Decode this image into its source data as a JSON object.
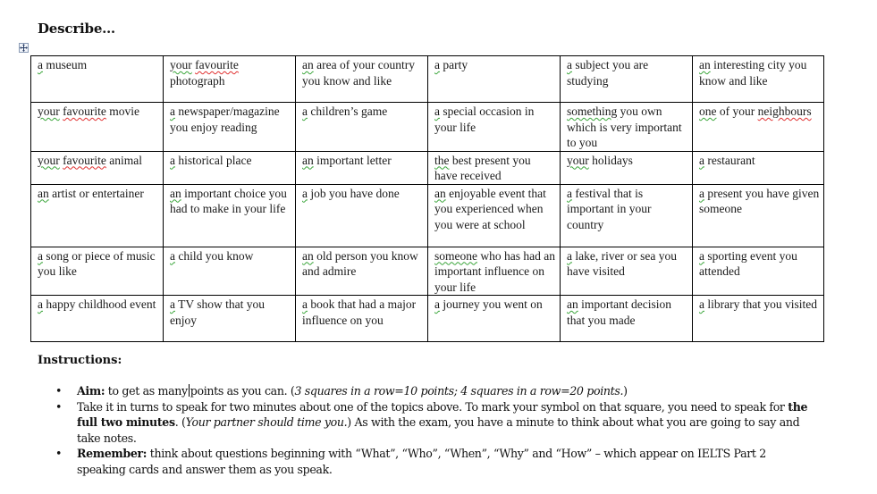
{
  "document": {
    "title": "Describe…",
    "move_handle_icon": "move-arrows-icon",
    "table": {
      "rows": [
        [
          {
            "first": "a",
            "rest": " museum",
            "first_check": "grammar"
          },
          {
            "first": "your",
            "mid": " ",
            "second": "favourite",
            "rest": " photograph",
            "first_check": "grammar",
            "second_check": "spelling"
          },
          {
            "first": "an",
            "rest": " area of your country you know and like",
            "first_check": "grammar"
          },
          {
            "first": "a",
            "rest": " party",
            "first_check": "grammar"
          },
          {
            "first": "a",
            "rest": " subject you are studying",
            "first_check": "grammar"
          },
          {
            "first": "an",
            "rest": " interesting city you know and like",
            "first_check": "grammar"
          }
        ],
        [
          {
            "first": "your",
            "mid": " ",
            "second": "favourite",
            "rest": " movie",
            "first_check": "grammar",
            "second_check": "spelling"
          },
          {
            "first": "a",
            "rest": " newspaper/magazine you enjoy reading",
            "first_check": "grammar"
          },
          {
            "first": "a",
            "rest": " children’s game",
            "first_check": "grammar"
          },
          {
            "first": "a",
            "rest": " special occasion in your life",
            "first_check": "grammar"
          },
          {
            "first": "something",
            "rest": " you own which is very important to you",
            "first_check": "grammar"
          },
          {
            "first": "one",
            "rest": " of your ",
            "second": "neighbours",
            "first_check": "grammar",
            "second_check": "spelling"
          }
        ],
        [
          {
            "first": "your",
            "mid": " ",
            "second": "favourite",
            "rest": " animal",
            "first_check": "grammar",
            "second_check": "spelling"
          },
          {
            "first": "a",
            "rest": " historical place",
            "first_check": "grammar"
          },
          {
            "first": "an",
            "rest": " important letter",
            "first_check": "grammar"
          },
          {
            "first": "the",
            "rest": " best present you have received",
            "first_check": "grammar"
          },
          {
            "first": "your",
            "rest": " holidays",
            "first_check": "grammar"
          },
          {
            "first": "a",
            "rest": " restaurant",
            "first_check": "grammar"
          }
        ],
        [
          {
            "first": "an",
            "rest": " artist or entertainer",
            "first_check": "grammar"
          },
          {
            "first": "an",
            "rest": " important choice you had to make in your life",
            "first_check": "grammar"
          },
          {
            "first": "a",
            "rest": " job you have done",
            "first_check": "grammar"
          },
          {
            "first": "an",
            "rest": " enjoyable event that you experienced when you were at school",
            "first_check": "grammar"
          },
          {
            "first": "a",
            "rest": " festival that is important in your country",
            "first_check": "grammar"
          },
          {
            "first": "a",
            "rest": " present you have given someone",
            "first_check": "grammar"
          }
        ],
        [
          {
            "first": "a",
            "rest": " song or piece of music you like",
            "first_check": "grammar"
          },
          {
            "first": "a",
            "rest": " child you know",
            "first_check": "grammar"
          },
          {
            "first": "an",
            "rest": " old person you know and admire",
            "first_check": "grammar"
          },
          {
            "first": "someone",
            "rest": " who has had an important influence on your life",
            "first_check": "grammar"
          },
          {
            "first": "a",
            "rest": " lake, river or sea you have visited",
            "first_check": "grammar"
          },
          {
            "first": "a",
            "rest": " sporting event you attended",
            "first_check": "grammar"
          }
        ],
        [
          {
            "first": "a",
            "rest": " happy childhood event",
            "first_check": "grammar"
          },
          {
            "first": "a",
            "rest": " TV show that you enjoy",
            "first_check": "grammar"
          },
          {
            "first": "a",
            "rest": " book that had a major influence on you",
            "first_check": "grammar"
          },
          {
            "first": "a",
            "rest": " journey you went on",
            "first_check": "grammar"
          },
          {
            "first": "an",
            "rest": " important decision that you made",
            "first_check": "grammar"
          },
          {
            "first": "a",
            "rest": " library that you visited",
            "first_check": "grammar"
          }
        ]
      ]
    },
    "instructions": {
      "heading": "Instructions:",
      "bullet_glyph": "•",
      "items": [
        {
          "label": "Aim:",
          "text_before_caret": " to get as many",
          "text_after_caret": "points as you can. (",
          "italic": "3 squares in a row=10 points; 4 squares in a row=20 points.",
          "tail": ")"
        },
        {
          "text1": "Take it in turns to speak for two minutes about one of the topics above. To mark your symbol on that square, you need to speak for ",
          "bold": "the full two minutes",
          "text2": ". (",
          "italic": "Your partner should time you.",
          "text3": ") As with the exam, you have a minute to think about what you are going to say and take notes."
        },
        {
          "label": "Remember:",
          "text": " think about questions beginning with “What”, “Who”, “When”, “Why” and “How” – which appear on IELTS Part 2 speaking cards and answer them as you speak."
        }
      ]
    }
  }
}
